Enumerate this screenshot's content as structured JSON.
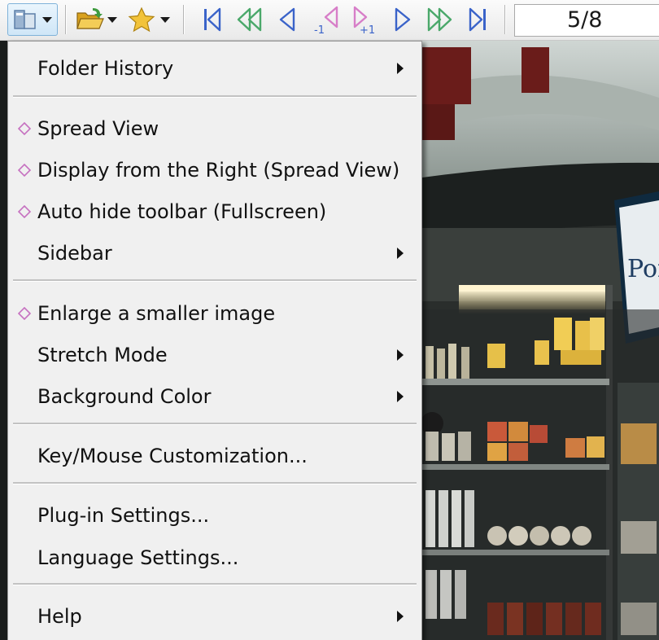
{
  "toolbar": {
    "buttons": [
      {
        "name": "view-menu-button",
        "icon": "view-layout-icon"
      },
      {
        "name": "open-folder-button",
        "icon": "folder-open-icon"
      },
      {
        "name": "favorites-button",
        "icon": "star-icon"
      },
      {
        "name": "first-page-button",
        "icon": "first-page-icon"
      },
      {
        "name": "previous-folder-button",
        "icon": "double-left-icon"
      },
      {
        "name": "previous-page-button",
        "icon": "left-arrow-icon"
      },
      {
        "name": "back-one-page-button",
        "icon": "minus-one-page-icon",
        "badge": "-1"
      },
      {
        "name": "forward-one-page-button",
        "icon": "plus-one-page-icon",
        "badge": "+1"
      },
      {
        "name": "next-page-button",
        "icon": "right-arrow-icon"
      },
      {
        "name": "next-folder-button",
        "icon": "double-right-icon"
      },
      {
        "name": "last-page-button",
        "icon": "last-page-icon"
      }
    ],
    "page_counter": "5/8"
  },
  "menu": {
    "items": [
      {
        "label": "Folder History",
        "submenu": true,
        "checked": false
      },
      {
        "label": "Spread View",
        "submenu": false,
        "checked": true
      },
      {
        "label": "Display from the Right (Spread View)",
        "submenu": false,
        "checked": true
      },
      {
        "label": "Auto hide toolbar (Fullscreen)",
        "submenu": false,
        "checked": true
      },
      {
        "label": "Sidebar",
        "submenu": true,
        "checked": false
      },
      {
        "label": "Enlarge a smaller image",
        "submenu": false,
        "checked": true
      },
      {
        "label": "Stretch Mode",
        "submenu": true,
        "checked": false
      },
      {
        "label": "Background Color",
        "submenu": true,
        "checked": false
      },
      {
        "label": "Key/Mouse Customization...",
        "submenu": false,
        "checked": false
      },
      {
        "label": "Plug-in Settings...",
        "submenu": false,
        "checked": false
      },
      {
        "label": "Language Settings...",
        "submenu": false,
        "checked": false
      },
      {
        "label": "Help",
        "submenu": true,
        "checked": false
      }
    ]
  },
  "colors": {
    "nav_blue": "#3a63c9",
    "nav_green": "#4aa86a",
    "nav_purple": "#a36bd9",
    "nav_pink": "#d77ec8",
    "check_marker": "#c671c0",
    "folder_yellow": "#e6b530",
    "star_yellow": "#f2c33a"
  },
  "photo_sign_text": "Por"
}
